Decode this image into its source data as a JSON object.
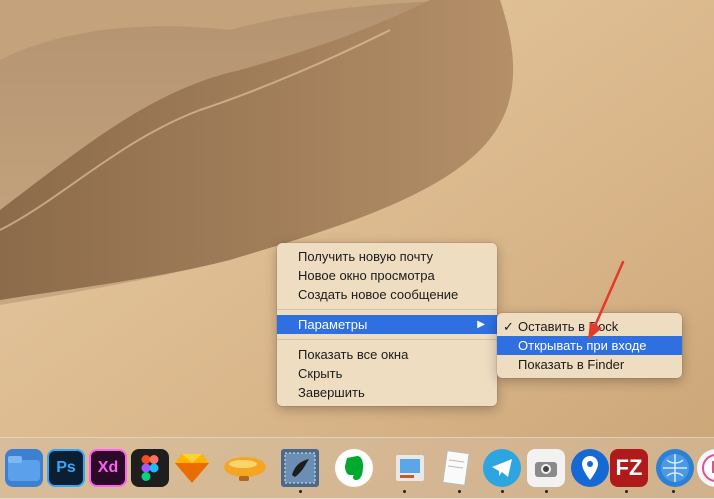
{
  "main_menu": {
    "items": [
      {
        "label": "Получить новую почту"
      },
      {
        "label": "Новое окно просмотра"
      },
      {
        "label": "Создать новое сообщение"
      }
    ],
    "parameters_label": "Параметры",
    "items_bottom": [
      {
        "label": "Показать все окна"
      },
      {
        "label": "Скрыть"
      },
      {
        "label": "Завершить"
      }
    ]
  },
  "sub_menu": {
    "keep_in_dock": "Оставить в Dock",
    "open_at_login": "Открывать при входе",
    "show_in_finder": "Показать в Finder"
  },
  "dock": {
    "photoshop_label": "Ps",
    "xd_label": "Xd",
    "filezilla_label": "FZ"
  },
  "colors": {
    "highlight": "#2f6fe0",
    "annotation_arrow": "#e53a2b"
  },
  "icons": [
    "folder-icon",
    "photoshop-icon",
    "adobe-xd-icon",
    "figma-icon",
    "sketch-icon",
    "blimp-icon",
    "mail-stamp-icon",
    "evernote-icon",
    "preview-icon",
    "notes-icon",
    "telegram-icon",
    "screenshot-icon",
    "pin-icon",
    "filezilla-icon",
    "globe-icon",
    "itunes-icon"
  ]
}
